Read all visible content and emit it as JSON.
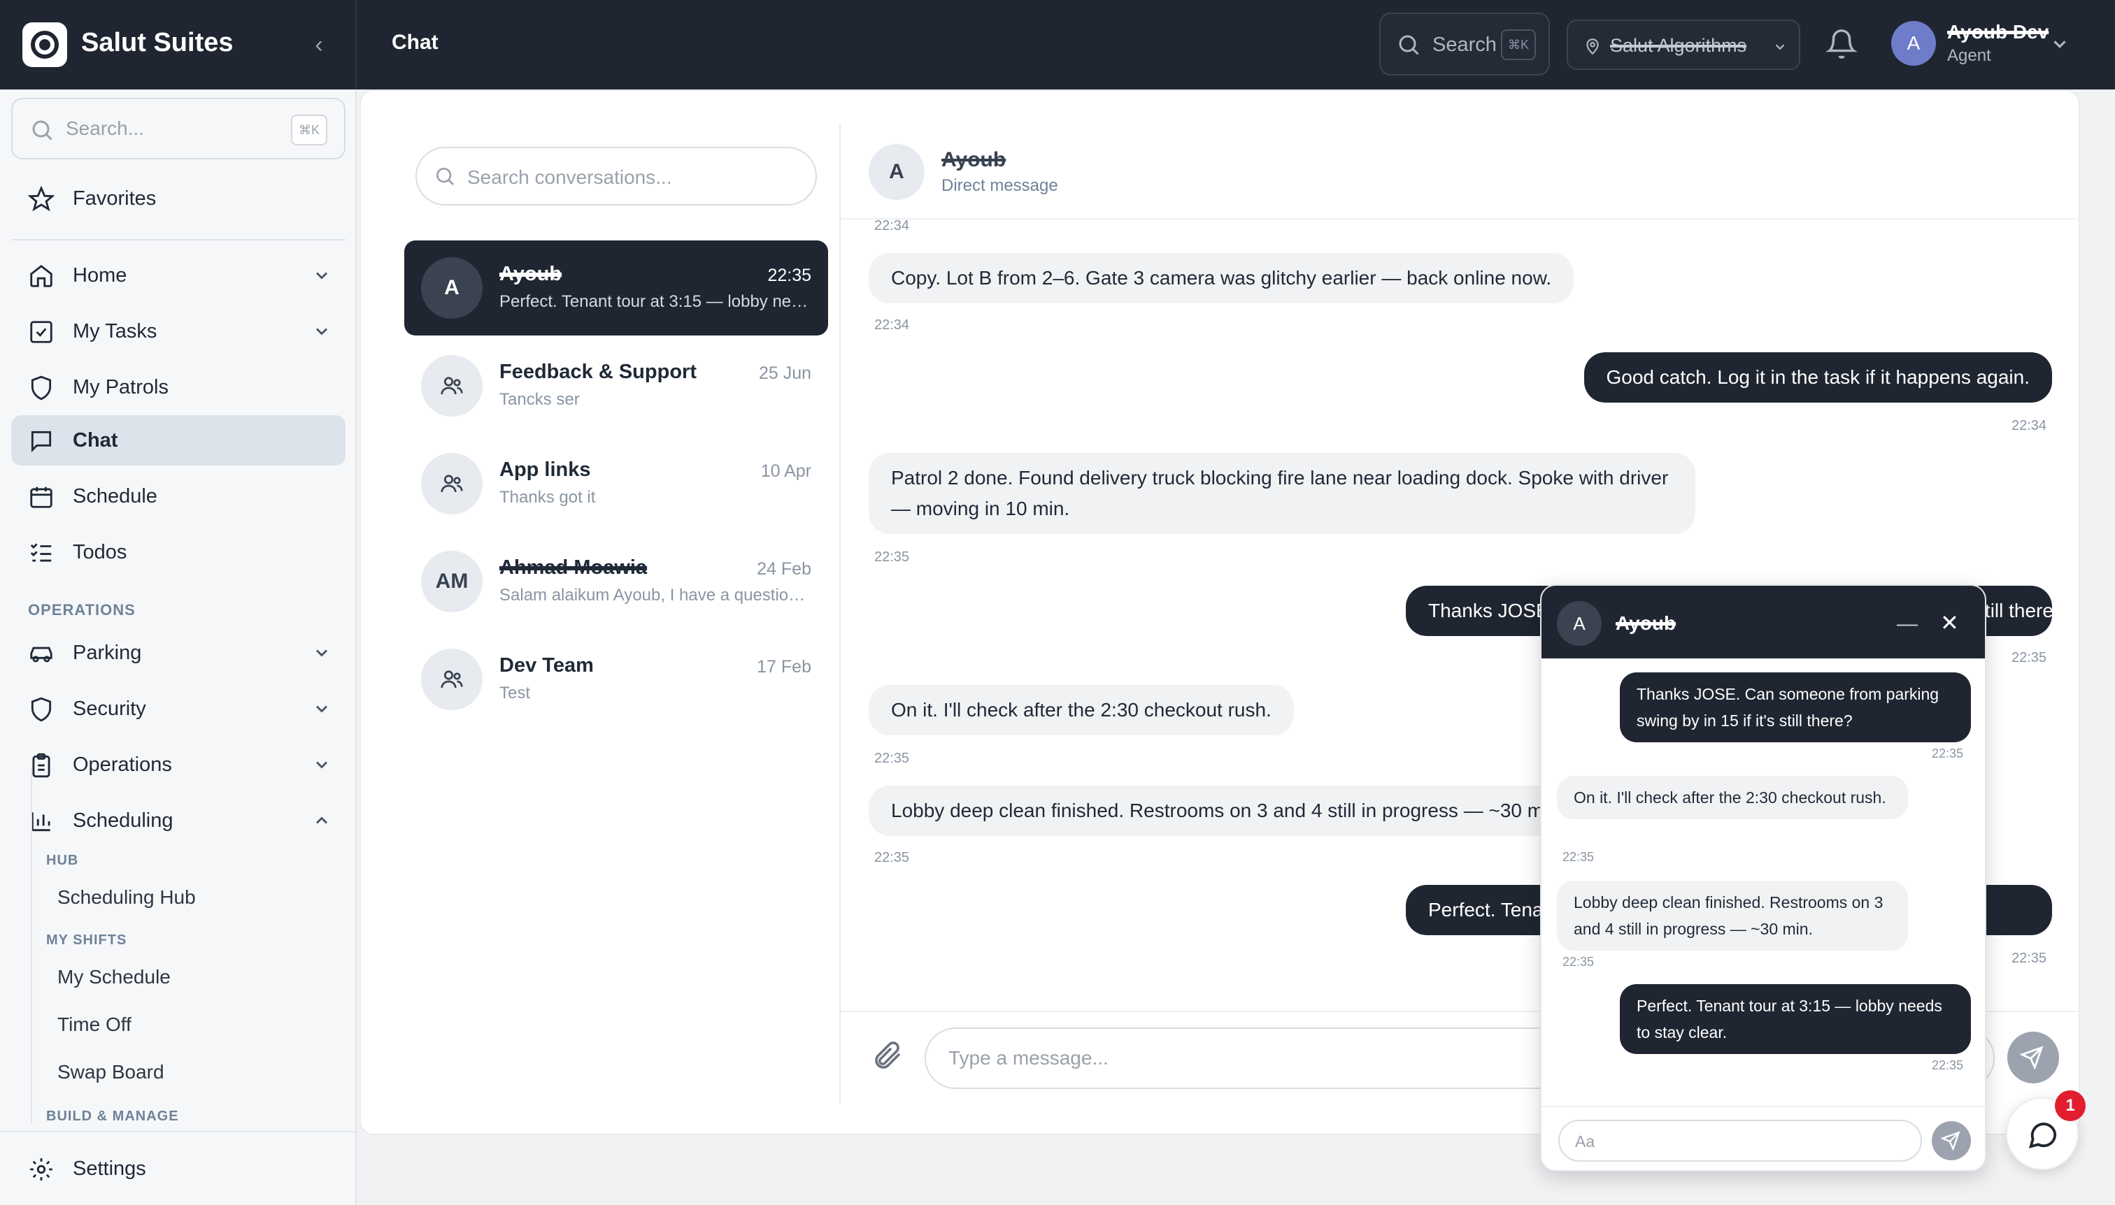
{
  "app": {
    "name": "Salut Suites",
    "page_title": "Chat"
  },
  "topbar": {
    "search_label": "Search",
    "search_shortcut": "⌘K",
    "location": "Salut Algorithms",
    "user": {
      "initial": "A",
      "name": "Ayoub Dev",
      "role": "Agent"
    }
  },
  "sidebar": {
    "search_placeholder": "Search...",
    "search_shortcut": "⌘K",
    "favorites": "Favorites",
    "items": [
      {
        "label": "Home",
        "icon": "home-icon"
      },
      {
        "label": "My Tasks",
        "icon": "checkbox-icon"
      },
      {
        "label": "My Patrols",
        "icon": "shield-icon"
      },
      {
        "label": "Chat",
        "icon": "chat-icon"
      },
      {
        "label": "Schedule",
        "icon": "calendar-icon"
      },
      {
        "label": "Todos",
        "icon": "list-icon"
      }
    ],
    "operations_heading": "OPERATIONS",
    "operations": [
      {
        "label": "Parking",
        "icon": "car-icon"
      },
      {
        "label": "Security",
        "icon": "shield-icon"
      },
      {
        "label": "Operations",
        "icon": "clipboard-icon"
      },
      {
        "label": "Scheduling",
        "icon": "bar-chart-icon"
      }
    ],
    "hub_heading": "HUB",
    "scheduling_hub": "Scheduling Hub",
    "my_shifts_heading": "MY SHIFTS",
    "my_schedule": "My Schedule",
    "time_off": "Time Off",
    "swap_board": "Swap Board",
    "build_heading": "BUILD & MANAGE",
    "settings": "Settings"
  },
  "conversations": {
    "search_placeholder": "Search conversations...",
    "list": [
      {
        "initials": "A",
        "name": "Ayoub",
        "time": "22:35",
        "preview": "Perfect. Tenant tour at 3:15 — lobby needs to stay clear.",
        "group": false
      },
      {
        "initials": "",
        "name": "Feedback & Support",
        "time": "25 Jun",
        "preview": "Tancks ser",
        "group": true
      },
      {
        "initials": "",
        "name": "App links",
        "time": "10 Apr",
        "preview": "Thanks got it",
        "group": true
      },
      {
        "initials": "AM",
        "name": "Ahmad Moawia",
        "time": "24 Feb",
        "preview": "Salam alaikum Ayoub, I have a question regarding",
        "group": false
      },
      {
        "initials": "",
        "name": "Dev Team",
        "time": "17 Feb",
        "preview": "Test",
        "group": true
      }
    ]
  },
  "chat": {
    "avatar": "A",
    "name": "Ayoub",
    "subtitle": "Direct message",
    "top_time": "22:34",
    "messages": [
      {
        "text": "Copy. Lot B from 2–6. Gate 3 camera was glitchy earlier — back online now.",
        "time": "22:34",
        "dir": "in"
      },
      {
        "text": "Good catch. Log it in the task if it happens again.",
        "time": "22:34",
        "dir": "out"
      },
      {
        "text": "Patrol 2 done. Found delivery truck blocking fire lane near loading dock. Spoke with driver — moving in 10 min.",
        "time": "22:35",
        "dir": "in"
      },
      {
        "text": "Thanks JOSE. Can someone from parking swing by in 15 if it's still there?",
        "time": "22:35",
        "dir": "out"
      },
      {
        "text": "On it. I'll check after the 2:30 checkout rush.",
        "time": "22:35",
        "dir": "in"
      },
      {
        "text": "Lobby deep clean finished. Restrooms on 3 and 4 still in progress — ~30 min.",
        "time": "22:35",
        "dir": "in"
      },
      {
        "text": "Perfect. Tenant tour at 3:15 — lobby needs to stay clear.",
        "time": "22:35",
        "dir": "out"
      }
    ],
    "input_placeholder": "Type a message..."
  },
  "popup": {
    "avatar": "A",
    "name": "Ayoub",
    "messages": [
      {
        "text": "Thanks JOSE. Can someone from parking swing by in 15 if it's still there?",
        "time": "22:35",
        "dir": "out"
      },
      {
        "text": "On it. I'll check after the 2:30 checkout rush.",
        "time": "22:35",
        "dir": "in"
      },
      {
        "text": "Lobby deep clean finished. Restrooms on 3 and 4 still in progress — ~30 min.",
        "time": "22:35",
        "dir": "in"
      },
      {
        "text": "Perfect. Tenant tour at 3:15 — lobby needs to stay clear.",
        "time": "22:35",
        "dir": "out"
      }
    ],
    "input_placeholder": "Aa"
  },
  "launcher": {
    "badge": "1"
  }
}
